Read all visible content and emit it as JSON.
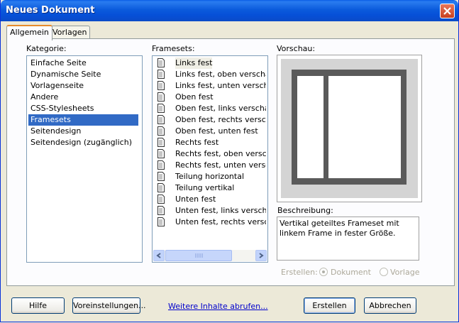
{
  "window": {
    "title": "Neues Dokument"
  },
  "tabs": [
    {
      "label": "Allgemein"
    },
    {
      "label": "Vorlagen"
    }
  ],
  "kategorie": {
    "label": "Kategorie:",
    "items": [
      {
        "label": "Einfache Seite"
      },
      {
        "label": "Dynamische Seite"
      },
      {
        "label": "Vorlagenseite"
      },
      {
        "label": "Andere"
      },
      {
        "label": "CSS-Stylesheets"
      },
      {
        "label": "Framesets"
      },
      {
        "label": "Seitendesign"
      },
      {
        "label": "Seitendesign (zugänglich)"
      }
    ],
    "selected": "Framesets"
  },
  "framesets": {
    "label": "Framesets:",
    "items": [
      {
        "label": "Links fest"
      },
      {
        "label": "Links fest, oben verschachtelt"
      },
      {
        "label": "Links fest, unten verschachtelt"
      },
      {
        "label": "Oben fest"
      },
      {
        "label": "Oben fest, links verschachtelt"
      },
      {
        "label": "Oben fest, rechts verschachtelt"
      },
      {
        "label": "Oben fest, unten fest"
      },
      {
        "label": "Rechts fest"
      },
      {
        "label": "Rechts fest, oben verschachtelt"
      },
      {
        "label": "Rechts fest, unten verschachtelt"
      },
      {
        "label": "Teilung horizontal"
      },
      {
        "label": "Teilung vertikal"
      },
      {
        "label": "Unten fest"
      },
      {
        "label": "Unten fest, links verschachtelt"
      },
      {
        "label": "Unten fest, rechts verschachtelt"
      }
    ],
    "selected": "Links fest",
    "icon": "document-icon"
  },
  "preview": {
    "label": "Vorschau:"
  },
  "beschreibung": {
    "label": "Beschreibung:",
    "text": "Vertikal geteiltes Frameset mit linkem Frame in fester Größe."
  },
  "erstellen": {
    "label": "Erstellen:",
    "options": [
      {
        "label": "Dokument",
        "checked": true
      },
      {
        "label": "Vorlage",
        "checked": false
      }
    ]
  },
  "buttons": {
    "hilfe": "Hilfe",
    "voreinstellungen": "Voreinstellungen...",
    "weitere": "Weitere Inhalte abrufen...",
    "erstellen": "Erstellen",
    "abbrechen": "Abbrechen"
  },
  "colors": {
    "titlebar": "#0a5ee6",
    "selection": "#316ac5",
    "link": "#0000cc"
  }
}
